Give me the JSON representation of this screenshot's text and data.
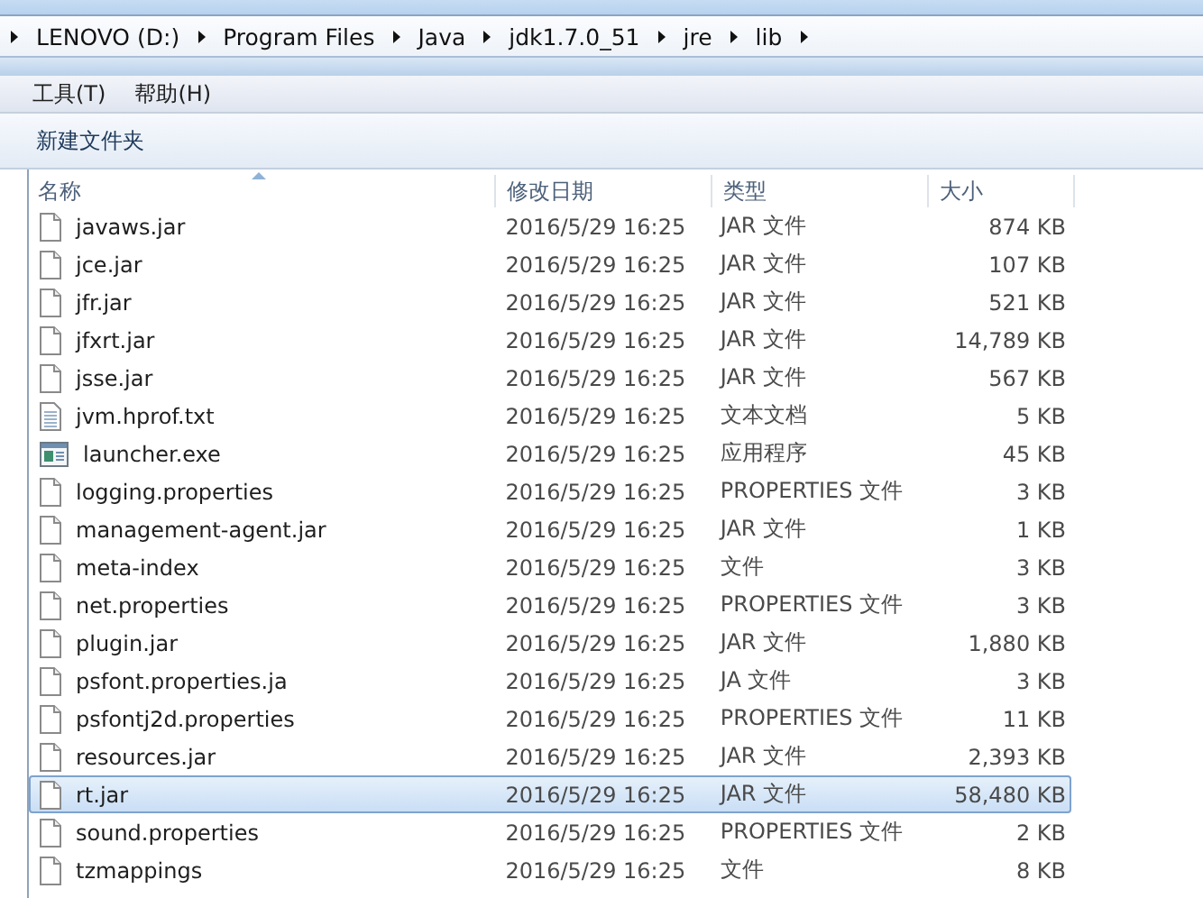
{
  "breadcrumb": [
    "LENOVO (D:)",
    "Program Files",
    "Java",
    "jdk1.7.0_51",
    "jre",
    "lib"
  ],
  "menu": [
    "工具(T)",
    "帮助(H)"
  ],
  "toolbar": [
    "新建文件夹"
  ],
  "table": {
    "columns": [
      "名称",
      "修改日期",
      "类型",
      "大小"
    ],
    "rows": [
      {
        "kind": "file",
        "name": "javaws.jar",
        "date": "2016/5/29 16:25",
        "type": "JAR 文件",
        "size": "874 KB",
        "selected": false
      },
      {
        "kind": "file",
        "name": "jce.jar",
        "date": "2016/5/29 16:25",
        "type": "JAR 文件",
        "size": "107 KB",
        "selected": false
      },
      {
        "kind": "file",
        "name": "jfr.jar",
        "date": "2016/5/29 16:25",
        "type": "JAR 文件",
        "size": "521 KB",
        "selected": false
      },
      {
        "kind": "file",
        "name": "jfxrt.jar",
        "date": "2016/5/29 16:25",
        "type": "JAR 文件",
        "size": "14,789 KB",
        "selected": false
      },
      {
        "kind": "file",
        "name": "jsse.jar",
        "date": "2016/5/29 16:25",
        "type": "JAR 文件",
        "size": "567 KB",
        "selected": false
      },
      {
        "kind": "text",
        "name": "jvm.hprof.txt",
        "date": "2016/5/29 16:25",
        "type": "文本文档",
        "size": "5 KB",
        "selected": false
      },
      {
        "kind": "exe",
        "name": "launcher.exe",
        "date": "2016/5/29 16:25",
        "type": "应用程序",
        "size": "45 KB",
        "selected": false
      },
      {
        "kind": "file",
        "name": "logging.properties",
        "date": "2016/5/29 16:25",
        "type": "PROPERTIES 文件",
        "size": "3 KB",
        "selected": false
      },
      {
        "kind": "file",
        "name": "management-agent.jar",
        "date": "2016/5/29 16:25",
        "type": "JAR 文件",
        "size": "1 KB",
        "selected": false
      },
      {
        "kind": "file",
        "name": "meta-index",
        "date": "2016/5/29 16:25",
        "type": "文件",
        "size": "3 KB",
        "selected": false
      },
      {
        "kind": "file",
        "name": "net.properties",
        "date": "2016/5/29 16:25",
        "type": "PROPERTIES 文件",
        "size": "3 KB",
        "selected": false
      },
      {
        "kind": "file",
        "name": "plugin.jar",
        "date": "2016/5/29 16:25",
        "type": "JAR 文件",
        "size": "1,880 KB",
        "selected": false
      },
      {
        "kind": "file",
        "name": "psfont.properties.ja",
        "date": "2016/5/29 16:25",
        "type": "JA 文件",
        "size": "3 KB",
        "selected": false
      },
      {
        "kind": "file",
        "name": "psfontj2d.properties",
        "date": "2016/5/29 16:25",
        "type": "PROPERTIES 文件",
        "size": "11 KB",
        "selected": false
      },
      {
        "kind": "file",
        "name": "resources.jar",
        "date": "2016/5/29 16:25",
        "type": "JAR 文件",
        "size": "2,393 KB",
        "selected": false
      },
      {
        "kind": "file",
        "name": "rt.jar",
        "date": "2016/5/29 16:25",
        "type": "JAR 文件",
        "size": "58,480 KB",
        "selected": true
      },
      {
        "kind": "file",
        "name": "sound.properties",
        "date": "2016/5/29 16:25",
        "type": "PROPERTIES 文件",
        "size": "2 KB",
        "selected": false
      },
      {
        "kind": "file",
        "name": "tzmappings",
        "date": "2016/5/29 16:25",
        "type": "文件",
        "size": "8 KB",
        "selected": false
      }
    ]
  }
}
